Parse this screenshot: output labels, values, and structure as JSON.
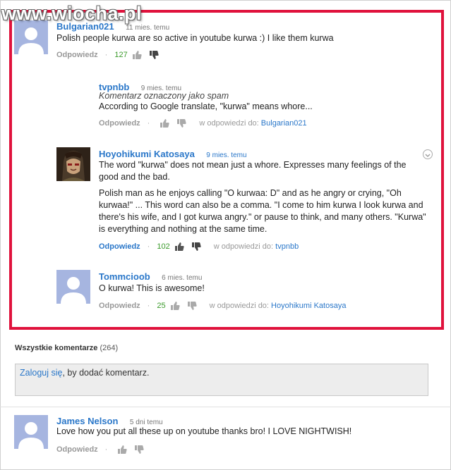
{
  "watermark": "www.wiocha.pl",
  "colors": {
    "highlight_border": "#e0123c",
    "link": "#2a77c9",
    "likes": "#3a9a2a"
  },
  "comments": [
    {
      "author": "Bulgarian021",
      "time": "11 mies. temu",
      "text": "Polish people kurwa are so active in youtube kurwa :) I like them kurwa",
      "reply_label": "Odpowiedz",
      "likes": "127",
      "avatar": "default-avatar"
    },
    {
      "author": "tvpnbb",
      "time": "9 mies. temu",
      "spam_label": "Komentarz oznaczony jako spam",
      "text": "According to Google translate, \"kurwa\" means whore...",
      "reply_label": "Odpowiedz",
      "in_reply_prefix": "w odpowiedzi do:",
      "in_reply_to": "Bulgarian021"
    },
    {
      "author": "Hoyohikumi Katosaya",
      "time": "9 mies. temu",
      "text1": "The word \"kurwa\" does not mean just a whore. Expresses many feelings of the good and the bad.",
      "text2": "Polish man as he enjoys calling \"O kurwaa: D\" and as he angry or crying, \"Oh kurwaa!\" ... This word can also be a comma. \"I come to him kurwa I look kurwa and there's his wife, and I got kurwa angry.\" or pause to think, and many others. \"Kurwa\" is everything and nothing at the same time.",
      "reply_label": "Odpowiedz",
      "likes": "102",
      "in_reply_prefix": "w odpowiedzi do:",
      "in_reply_to": "tvpnbb",
      "avatar": "anime-character-avatar"
    },
    {
      "author": "Tommcioob",
      "time": "6 mies. temu",
      "text": "O kurwa! This is awesome!",
      "reply_label": "Odpowiedz",
      "likes": "25",
      "in_reply_prefix": "w odpowiedzi do:",
      "in_reply_to": "Hoyohikumi Katosaya"
    }
  ],
  "all_comments": {
    "label": "Wszystkie komentarze",
    "count": "(264)",
    "login_link": "Zaloguj się",
    "login_suffix": ", by dodać komentarz."
  },
  "bottom_comment": {
    "author": "James Nelson",
    "time": "5 dni temu",
    "text": "Love how you put all these up on youtube thanks bro! I LOVE NIGHTWISH!",
    "reply_label": "Odpowiedz"
  }
}
